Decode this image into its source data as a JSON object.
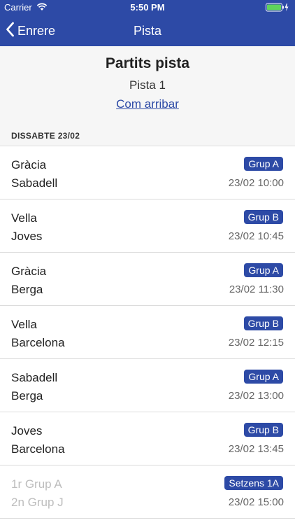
{
  "status_bar": {
    "carrier": "Carrier",
    "time": "5:50 PM"
  },
  "nav": {
    "back_label": "Enrere",
    "title": "Pista"
  },
  "header": {
    "title": "Partits pista",
    "court": "Pista 1",
    "directions_link": "Com arribar"
  },
  "section": {
    "label": "DISSABTE 23/02"
  },
  "matches": [
    {
      "team1": "Gràcia",
      "team2": "Sabadell",
      "group": "Grup A",
      "datetime": "23/02 10:00"
    },
    {
      "team1": "Vella",
      "team2": "Joves",
      "group": "Grup B",
      "datetime": "23/02 10:45"
    },
    {
      "team1": "Gràcia",
      "team2": "Berga",
      "group": "Grup A",
      "datetime": "23/02 11:30"
    },
    {
      "team1": "Vella",
      "team2": "Barcelona",
      "group": "Grup B",
      "datetime": "23/02 12:15"
    },
    {
      "team1": "Sabadell",
      "team2": "Berga",
      "group": "Grup A",
      "datetime": "23/02 13:00"
    },
    {
      "team1": "Joves",
      "team2": "Barcelona",
      "group": "Grup B",
      "datetime": "23/02 13:45"
    },
    {
      "team1": "1r Grup A",
      "team2": "2n Grup J",
      "group": "Setzens 1A",
      "datetime": "23/02 15:00"
    }
  ],
  "colors": {
    "accent": "#2d4aa6",
    "pending_text": "#bdbdbd"
  },
  "icons": {
    "back": "chevron-left-icon",
    "wifi": "wifi-icon",
    "battery": "battery-icon"
  }
}
